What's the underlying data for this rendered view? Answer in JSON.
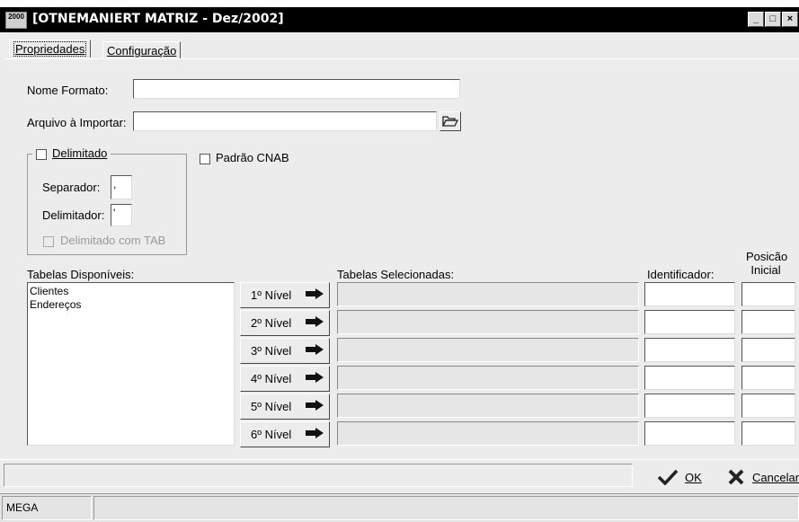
{
  "window": {
    "title": "[OTNEMANIERT MATRIZ - Dez/2002]",
    "icon_text": "2000",
    "controls": [
      "_",
      "□",
      "×"
    ]
  },
  "tabs": [
    {
      "label": "Propriedades",
      "active": true
    },
    {
      "label": "Configuração",
      "active": false
    }
  ],
  "form": {
    "nome_formato_label": "Nome Formato:",
    "nome_formato_value": "",
    "arquivo_label": "Arquivo à Importar:",
    "arquivo_value": "",
    "delimitado_label": "Delimitado",
    "separador_label": "Separador:",
    "separador_value": ",",
    "delimitador_label": "Delimitador:",
    "delimitador_value": "'",
    "delimitado_tab_label": "Delimitado com TAB",
    "padrao_cnab_label": "Padrão CNAB"
  },
  "tabelas": {
    "disponiveis_label": "Tabelas Disponíveis:",
    "disponiveis_items": [
      "Clientes",
      "Endereços"
    ],
    "selecionadas_label": "Tabelas Selecionadas:",
    "identificador_label": "Identificador:",
    "posicao_label_1": "Posicão",
    "posicao_label_2": "Inicial",
    "niveis": [
      "1º Nível",
      "2º Nível",
      "3º Nível",
      "4º Nível",
      "5º Nível",
      "6º Nível"
    ]
  },
  "actions": {
    "ok_label": "OK",
    "cancel_label": "Cancelar"
  },
  "status": {
    "panel_1": "MEGA",
    "panel_2": ""
  },
  "colors": {
    "titlebar": "#000000",
    "window_bg": "#ececec",
    "ok_check": "#222222",
    "cancel_x": "#222222"
  }
}
